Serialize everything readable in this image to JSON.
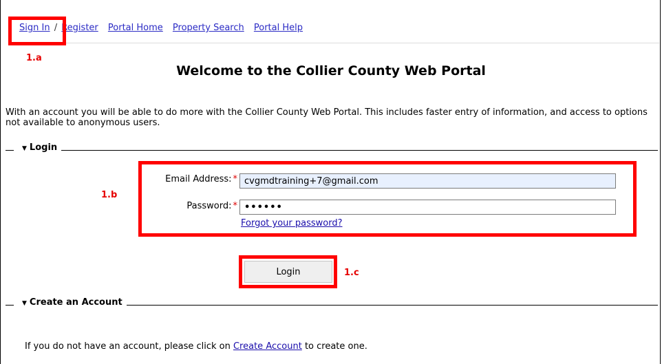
{
  "nav": {
    "sign_in": "Sign In",
    "separator": "/",
    "register": "Register",
    "portal_home": "Portal Home",
    "property_search": "Property Search",
    "portal_help": "Portal Help"
  },
  "page_title": "Welcome to the Collier County Web Portal",
  "intro_text": "With an account you will be able to do more with the Collier County Web Portal. This includes faster entry of information, and access to options not available to anonymous users.",
  "login_section": {
    "legend": "Login",
    "email_label": "Email Address:",
    "email_value": "cvgmdtraining+7@gmail.com",
    "password_label": "Password:",
    "password_value": "••••••",
    "required_mark": "*",
    "forgot_link": "Forgot your password?",
    "login_button": "Login"
  },
  "create_section": {
    "legend": "Create an Account",
    "text_before": "If you do not have an account, please click on ",
    "link": "Create Account",
    "text_after": " to create one."
  },
  "annotations": {
    "callout_a": "1.a",
    "callout_b": "1.b",
    "callout_c": "1.c",
    "highlight_color": "#ff0000"
  },
  "icons": {
    "collapse": "triangle-down-icon"
  }
}
